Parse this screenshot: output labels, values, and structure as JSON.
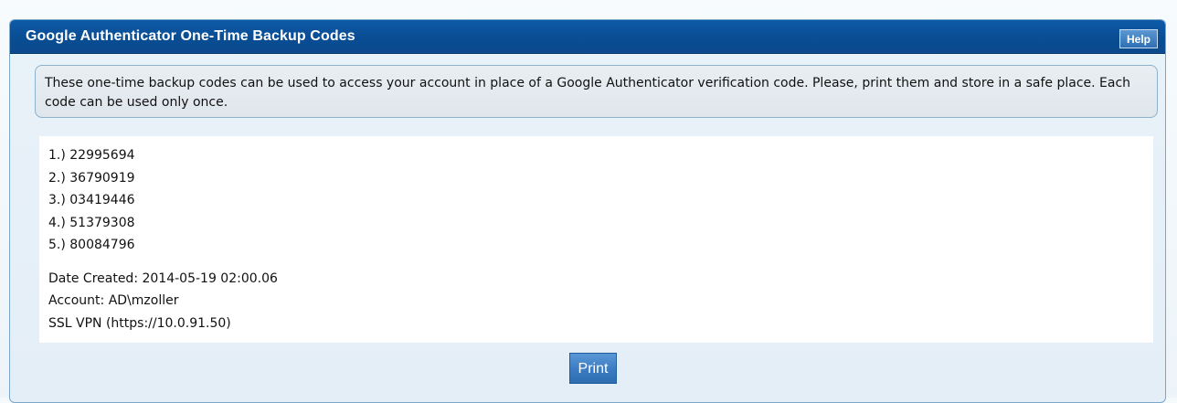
{
  "panel": {
    "title": "Google Authenticator One-Time Backup Codes",
    "help_label": "Help"
  },
  "info": {
    "text": "These one-time backup codes can be used to access your account in place of a Google Authenticator verification code. Please, print them and store in a safe place. Each code can be used only once."
  },
  "codes": [
    "1.) 22995694",
    "2.) 36790919",
    "3.) 03419446",
    "4.) 51379308",
    "5.) 80084796"
  ],
  "meta": {
    "date_created": "Date Created: 2014-05-19 02:00.06",
    "account": "Account: AD\\mzoller",
    "service": "SSL VPN (https://10.0.91.50)"
  },
  "actions": {
    "print_label": "Print"
  },
  "colors": {
    "header": "#0b4f97",
    "panel_border": "#7da7c9",
    "info_bg": "#e3e9ee",
    "button": "#3a7bc1"
  }
}
